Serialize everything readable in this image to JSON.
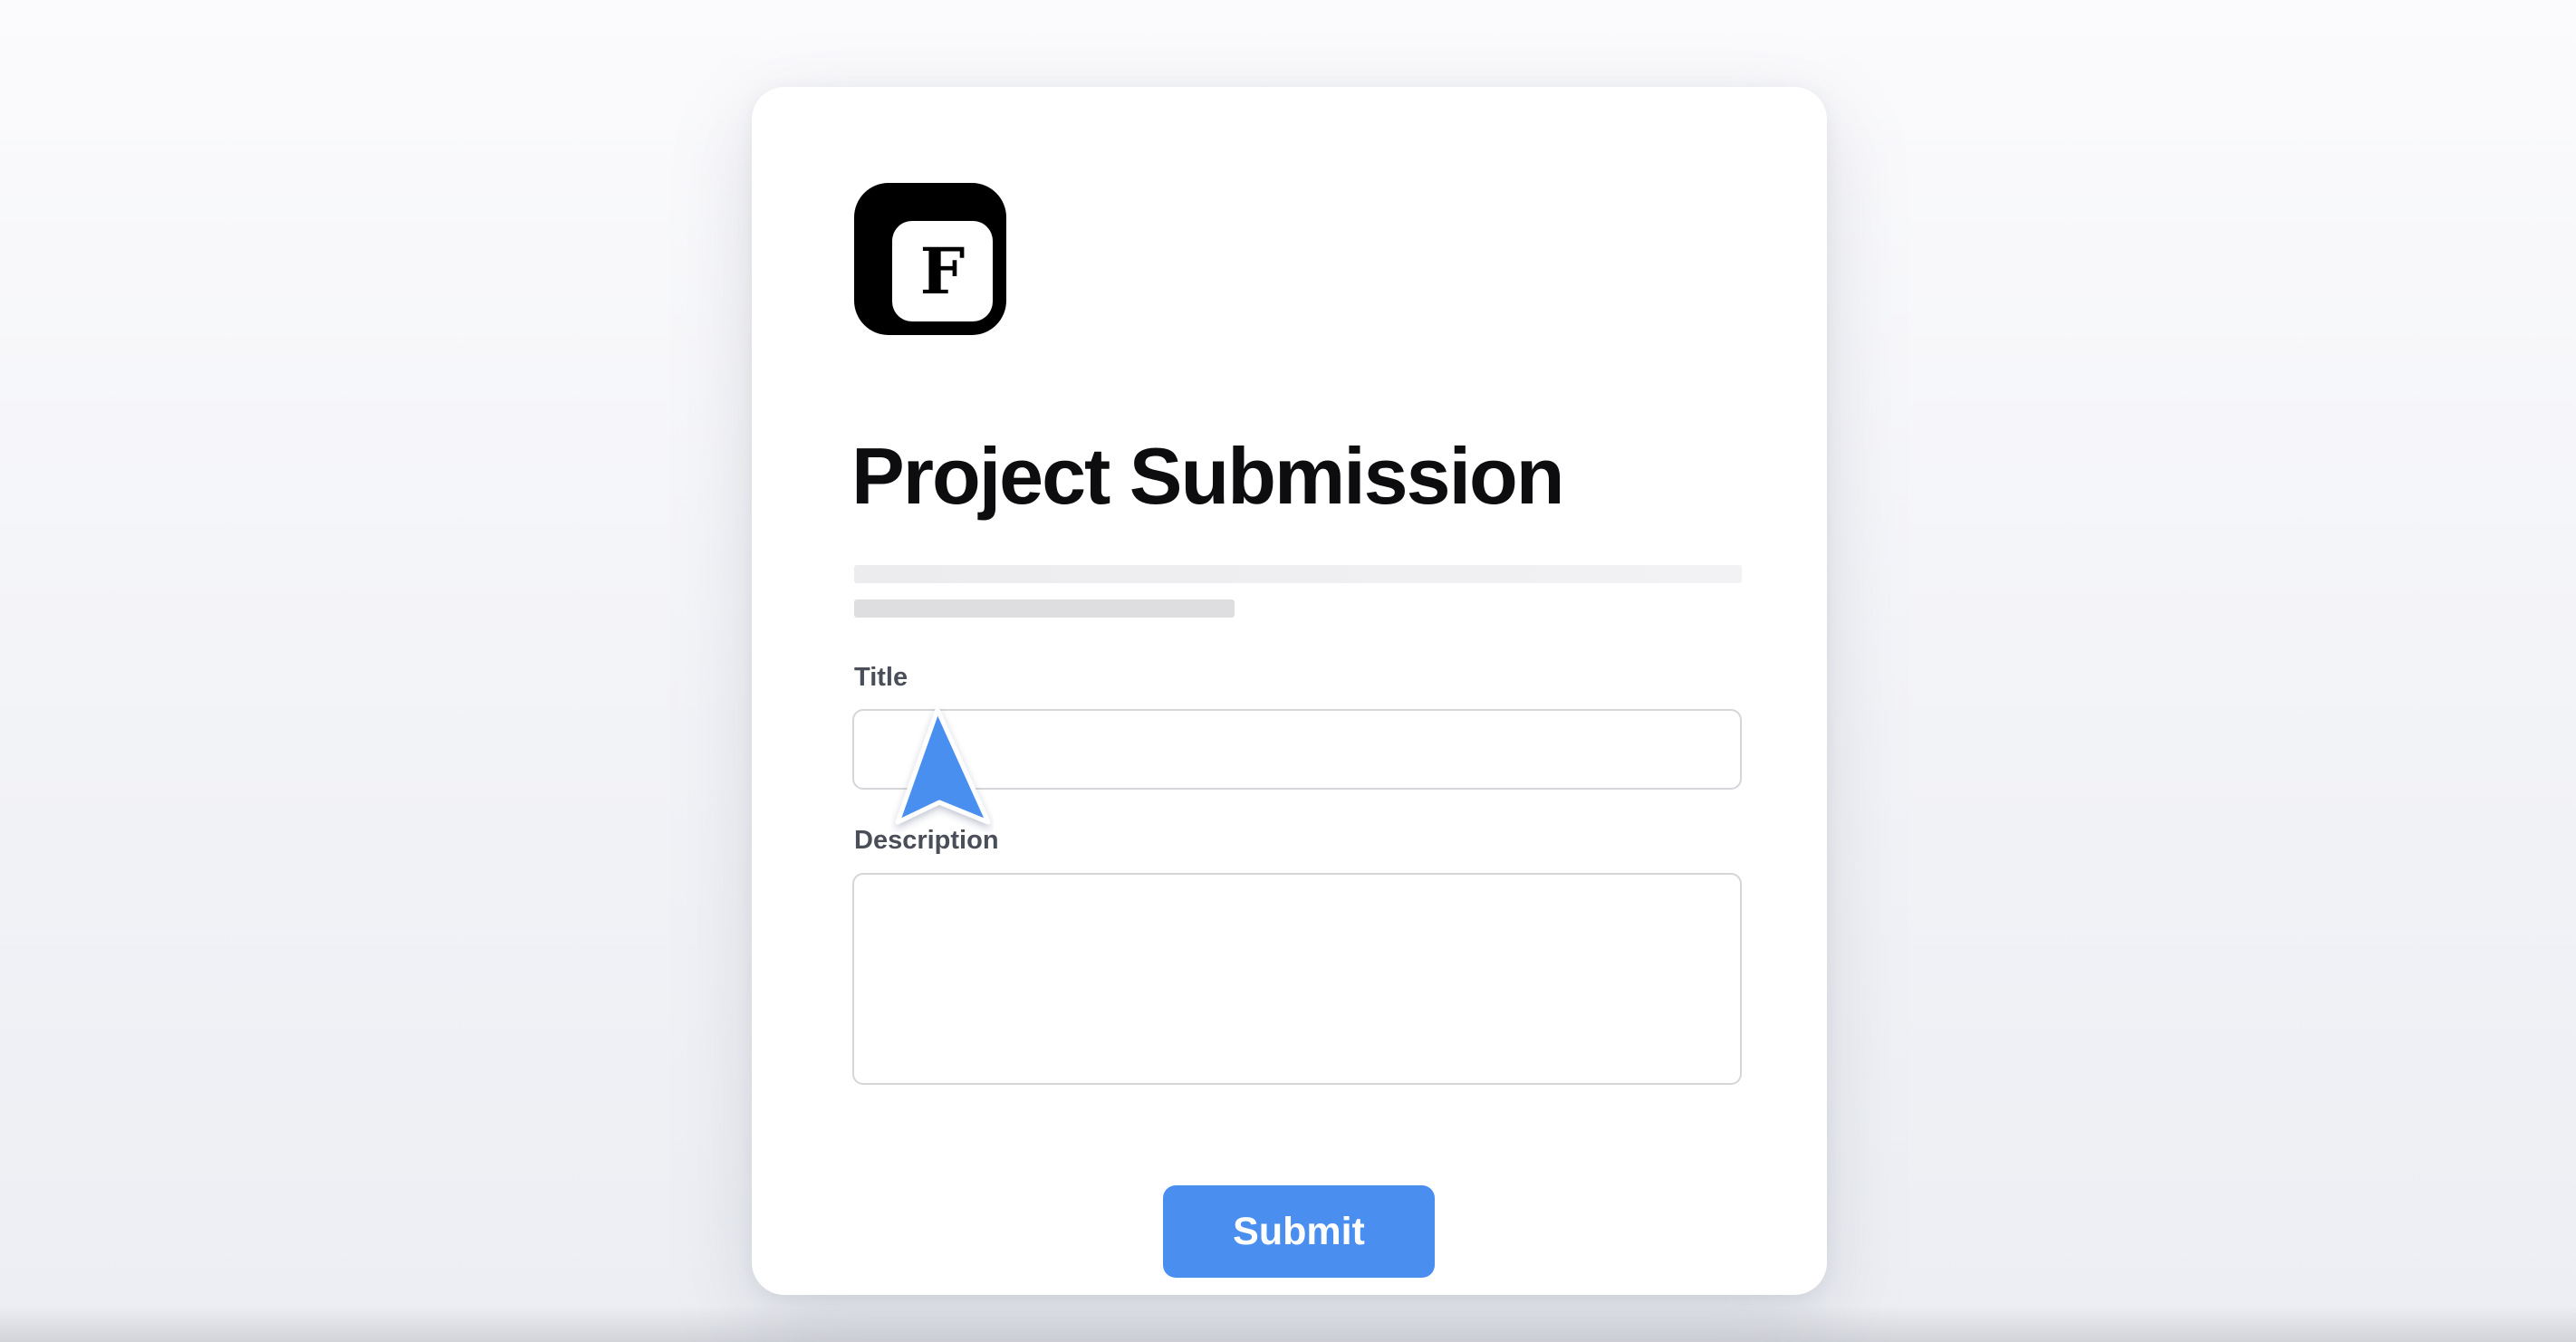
{
  "form": {
    "logo_letter": "F",
    "title": "Project Submission",
    "fields": {
      "title": {
        "label": "Title",
        "value": "",
        "placeholder": ""
      },
      "description": {
        "label": "Description",
        "value": "",
        "placeholder": ""
      }
    },
    "submit_label": "Submit"
  },
  "colors": {
    "accent": "#4a8ff0",
    "logo": "#000000",
    "label": "#4a4e59",
    "input_border": "#d5d6da"
  },
  "icons": {
    "logo": "app-logo-icon",
    "pointer": "mouse-pointer-icon"
  }
}
